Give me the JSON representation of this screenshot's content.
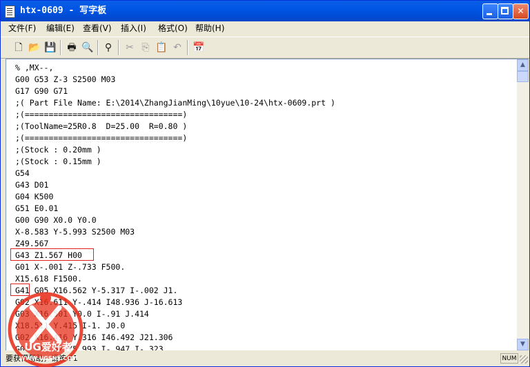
{
  "window": {
    "title": "htx-0609 - 写字板",
    "minimize_label": "",
    "maximize_label": "",
    "close_label": "✕"
  },
  "menu": [
    {
      "label": "文件(F)"
    },
    {
      "label": "编辑(E)"
    },
    {
      "label": "查看(V)"
    },
    {
      "label": "插入(I)"
    },
    {
      "label": "格式(O)"
    },
    {
      "label": "帮助(H)"
    }
  ],
  "toolbar": {
    "buttons": [
      {
        "name": "new-document",
        "icon": "🗋",
        "enabled": true
      },
      {
        "name": "open",
        "icon": "📂",
        "enabled": true
      },
      {
        "name": "save",
        "icon": "💾",
        "enabled": true
      },
      {
        "name": "print",
        "icon": "🖶",
        "enabled": true
      },
      {
        "name": "print-preview",
        "icon": "🔍",
        "enabled": true
      },
      {
        "name": "find",
        "icon": "⚲",
        "enabled": true
      },
      {
        "name": "cut",
        "icon": "✂",
        "enabled": false
      },
      {
        "name": "copy",
        "icon": "⎘",
        "enabled": false
      },
      {
        "name": "paste",
        "icon": "📋",
        "enabled": true
      },
      {
        "name": "undo",
        "icon": "↶",
        "enabled": false
      },
      {
        "name": "date-time",
        "icon": "📅",
        "enabled": true
      }
    ]
  },
  "document": {
    "lines": [
      "% ,MX--,",
      "G00 G53 Z-3 S2500 M03",
      "G17 G90 G71",
      ";( Part File Name: E:\\2014\\ZhangJianMing\\10yue\\10-24\\htx-0609.prt )",
      ";(=================================)",
      ";(ToolName=25R0.8  D=25.00  R=0.80 )",
      ";(=================================)",
      ";(Stock : 0.20mm )",
      ";(Stock : 0.15mm )",
      "G54",
      "G43 D01",
      "G04 K500",
      "G51 E0.01",
      "G00 G90 X0.0 Y0.0",
      "X-8.583 Y-5.993 S2500 M03",
      "Z49.567",
      "G43 Z1.567 H00",
      "G01 X-.001 Z-.733 F500.",
      "X15.618 F1500.",
      "G41 G05 X16.562 Y-5.317 I-.002 J1.",
      "G02 X16.611 Y-.414 I48.936 J-16.613",
      "G03 X16.501 Y0.0 I-.91 J.414",
      "X18.511 Y.415 I-1. J0.0",
      "G02 X16.416 Y.316 I46.492 J21.306",
      "G01 X15.62 Y5.993 I-.947 I-.323"
    ]
  },
  "status": {
    "help_text": "要获得帮助，请按 F1",
    "num_lock": "NUM"
  },
  "watermark": {
    "text": "UG爱好者",
    "url": "WWW.UGSNX.COM"
  },
  "colors": {
    "titlebar": "#0054e3",
    "highlight_box": "#e02020",
    "watermark": "#e8301c"
  }
}
